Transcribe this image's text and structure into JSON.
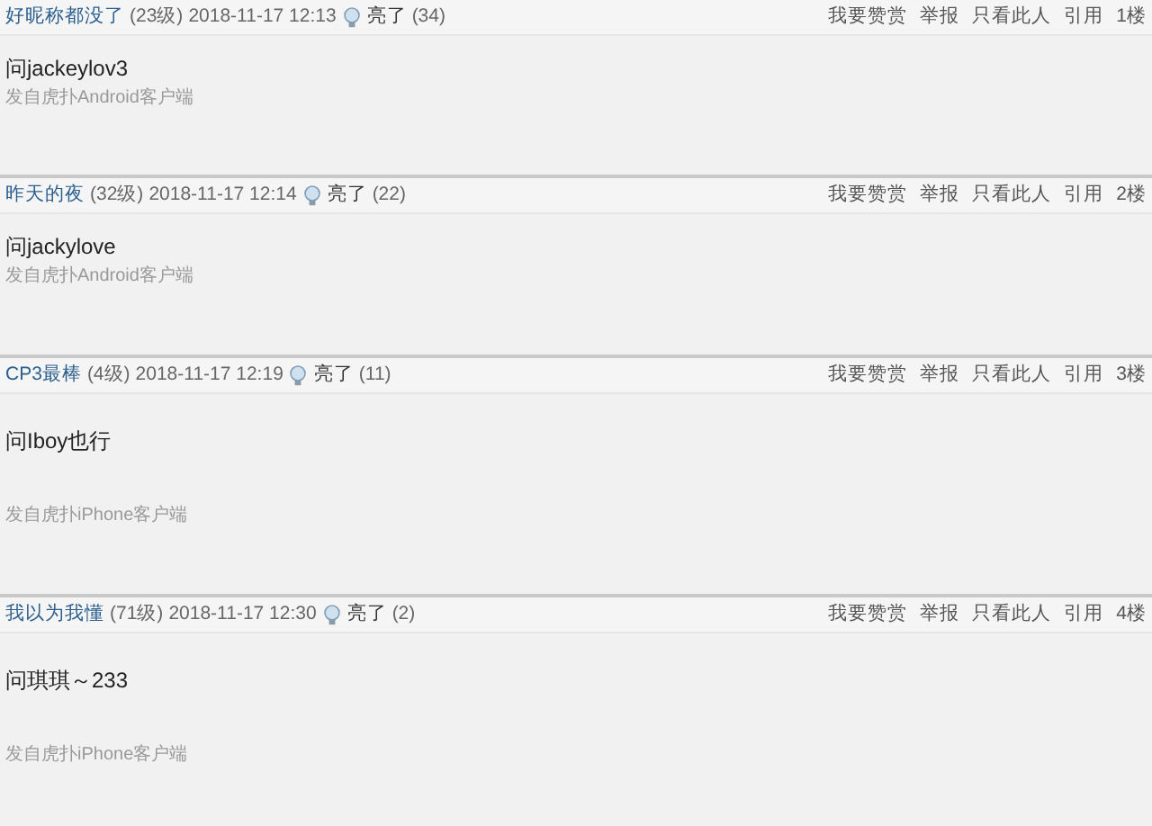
{
  "posts": [
    {
      "user": "好昵称都没了",
      "level": "(23级)",
      "time": "2018-11-17 12:13",
      "light_label": "亮了",
      "light_count": "(34)",
      "actions": [
        "我要赞赏",
        "举报",
        "只看此人",
        "引用"
      ],
      "floor": "1楼",
      "content": "问jackeylov3",
      "source": "发自虎扑Android客户端"
    },
    {
      "user": "昨天的夜",
      "level": "(32级)",
      "time": "2018-11-17 12:14",
      "light_label": "亮了",
      "light_count": "(22)",
      "actions": [
        "我要赞赏",
        "举报",
        "只看此人",
        "引用"
      ],
      "floor": "2楼",
      "content": "问jackylove",
      "source": "发自虎扑Android客户端"
    },
    {
      "user": "CP3最棒",
      "level": "(4级)",
      "time": "2018-11-17 12:19",
      "light_label": "亮了",
      "light_count": "(11)",
      "actions": [
        "我要赞赏",
        "举报",
        "只看此人",
        "引用"
      ],
      "floor": "3楼",
      "content": "问Iboy也行",
      "source": "发自虎扑iPhone客户端"
    },
    {
      "user": "我以为我懂",
      "level": "(71级)",
      "time": "2018-11-17 12:30",
      "light_label": "亮了",
      "light_count": "(2)",
      "actions": [
        "我要赞赏",
        "举报",
        "只看此人",
        "引用"
      ],
      "floor": "4楼",
      "content": "问琪琪～233",
      "source": "发自虎扑iPhone客户端"
    }
  ]
}
